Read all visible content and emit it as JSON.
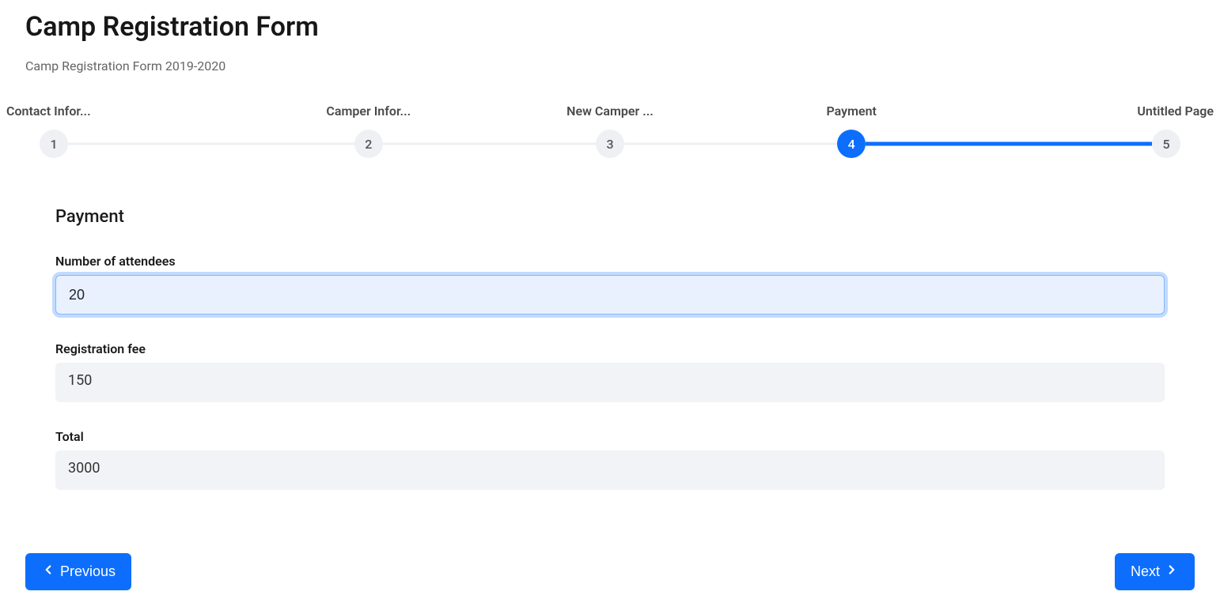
{
  "header": {
    "title": "Camp Registration Form",
    "subtitle": "Camp Registration Form 2019-2020"
  },
  "stepper": {
    "steps": [
      {
        "label": "Contact Infor...",
        "num": "1",
        "active": false
      },
      {
        "label": "Camper Infor...",
        "num": "2",
        "active": false
      },
      {
        "label": "New Camper ...",
        "num": "3",
        "active": false
      },
      {
        "label": "Payment",
        "num": "4",
        "active": true
      },
      {
        "label": "Untitled Page",
        "num": "5",
        "active": false
      }
    ]
  },
  "section": {
    "title": "Payment"
  },
  "fields": {
    "attendees": {
      "label": "Number of attendees",
      "value": "20"
    },
    "fee": {
      "label": "Registration fee",
      "value": "150"
    },
    "total": {
      "label": "Total",
      "value": "3000"
    }
  },
  "nav": {
    "prev": "Previous",
    "next": "Next"
  }
}
